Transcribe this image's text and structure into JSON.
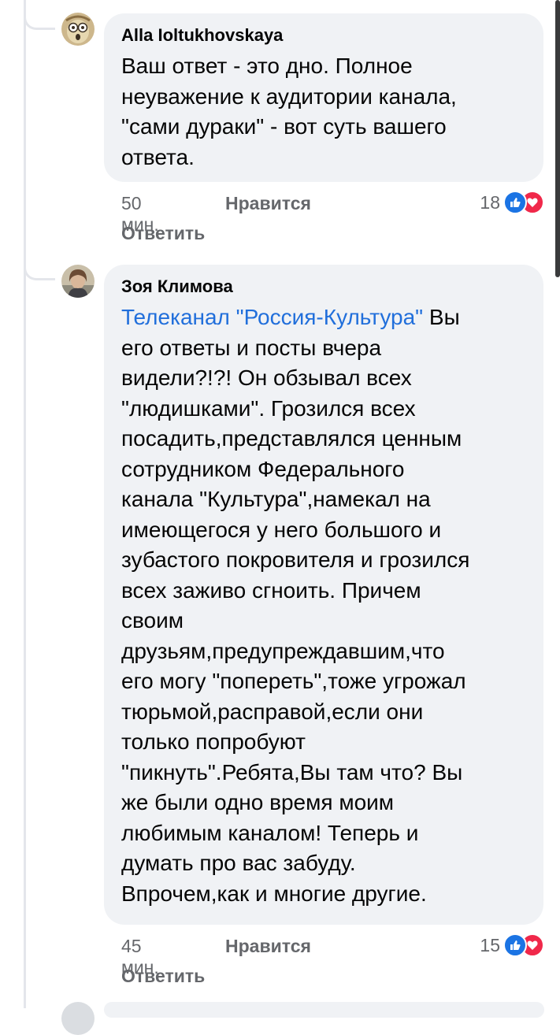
{
  "comments": [
    {
      "author": "Alla Ioltukhovskaya",
      "text": "Ваш ответ - это дно. Полное\nнеуважение к аудитории канала,\n\"сами дураки\" - вот суть вашего\nответа.",
      "time": "50 мин.",
      "like_label": "Нравится",
      "reply_label": "Ответить",
      "reaction_count": "18",
      "avatar_icon": "cartoon-face-avatar"
    },
    {
      "author": "Зоя Климова",
      "mention": "Телеканал \"Россия-Культура\"",
      "text": " Вы\nего ответы и посты вчера\nвидели?!?! Он обзывал всех\n\"людишками\". Грозился всех\nпосадить,представлялся ценным\nсотрудником Федерального\nканала \"Культура\",намекал на\nимеющегося у него большого и\nзубастого покровителя и грозился\nвсех заживо сгноить. Причем\nсвоим\nдрузьям,предупреждавшим,что\nего могу \"попереть\",тоже угрожал\nтюрьмой,расправой,если они\nтолько попробуют\n\"пикнуть\".Ребята,Вы там что? Вы\nже были одно время моим\nлюбимым каналом! Теперь и\nдумать про вас забуду.\nВпрочем,как и многие другие.",
      "time": "45 мин.",
      "like_label": "Нравится",
      "reply_label": "Ответить",
      "reaction_count": "15",
      "avatar_icon": "profile-photo-avatar"
    }
  ],
  "colors": {
    "bubble": "#f0f2f5",
    "mention": "#216fdb",
    "like_reaction": "#1b74e4",
    "love_reaction": "#f0284a",
    "meta_text": "#65676b"
  }
}
